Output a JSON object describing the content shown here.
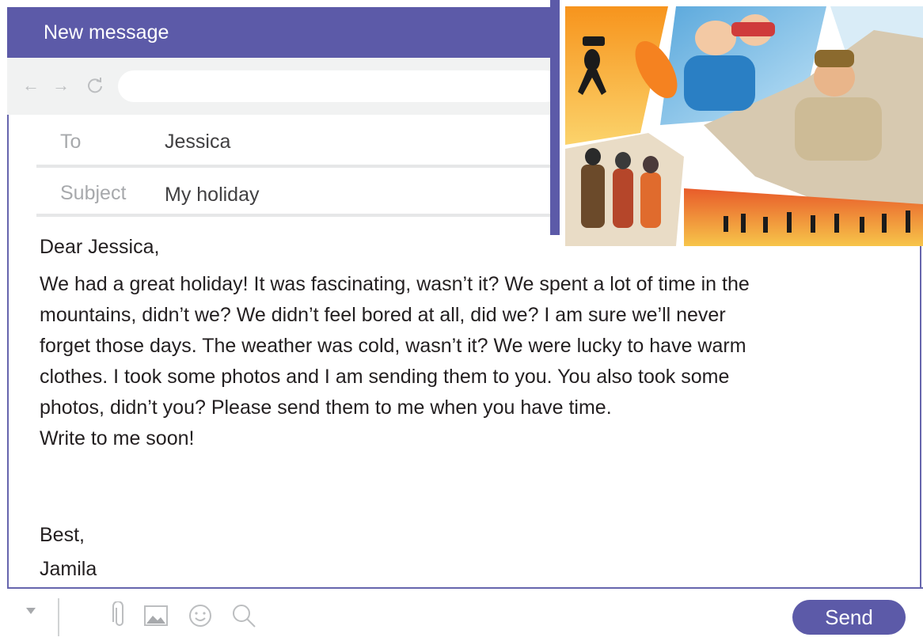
{
  "window": {
    "title": "New message"
  },
  "navbar": {
    "back_icon": "arrow-left-icon",
    "forward_icon": "arrow-right-icon",
    "reload_icon": "reload-icon",
    "address": ""
  },
  "fields": {
    "to_label": "To",
    "to_value": "Jessica",
    "subject_label": "Subject",
    "subject_value": "My holiday"
  },
  "message": {
    "greeting": "Dear Jessica,",
    "lines": [
      "We had a great holiday! It was fascinating, wasn’t it? We spent a lot of time in the",
      "mountains, didn’t we? We didn’t feel bored at all, did we? I am sure we’ll never",
      "forget those days. The weather was cold, wasn’t it? We were lucky to have warm",
      "clothes. I took some photos and I am sending them to you. You also took some",
      "photos, didn’t you? Please send them to me when you have time.",
      "Write to me soon!"
    ],
    "closing": "Best,",
    "signature": "Jamila"
  },
  "toolbar": {
    "icons": [
      "chevron-down-icon",
      "paperclip-icon",
      "image-icon",
      "emoji-icon",
      "search-icon"
    ],
    "send_label": "Send"
  },
  "colors": {
    "accent": "#5c5aa8",
    "nav_bg": "#f1f2f2",
    "muted": "#a7a9ac"
  }
}
